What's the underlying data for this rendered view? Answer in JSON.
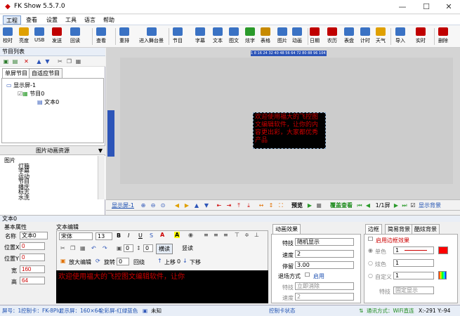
{
  "window": {
    "title": "FK Show 5.5.7.0",
    "minimize": "—",
    "maximize": "☐",
    "close": "✕"
  },
  "menu": [
    "工程",
    "查看",
    "设置",
    "工具",
    "语言",
    "帮助"
  ],
  "toolbar": [
    {
      "label": "校时",
      "icon": "clock-icon",
      "color": "#3a72c4"
    },
    {
      "label": "亮度",
      "icon": "brightness-icon",
      "color": "#e0a000"
    },
    {
      "label": "USB",
      "icon": "usb-icon",
      "color": "#3a72c4"
    },
    {
      "label": "发送",
      "icon": "send-icon",
      "color": "#c00000"
    },
    {
      "label": "回读",
      "icon": "readback-icon",
      "color": "#3a72c4"
    },
    {
      "label": "查看",
      "icon": "view-icon",
      "color": "#3a72c4"
    },
    {
      "label": "重排",
      "icon": "rearrange-icon",
      "color": "#3a72c4"
    },
    {
      "label": "进入舞台景",
      "icon": "stage-icon",
      "color": "#3a72c4"
    },
    {
      "label": "节目",
      "icon": "program-icon",
      "color": "#3a72c4"
    },
    {
      "label": "字幕",
      "icon": "subtitle-icon",
      "color": "#3a72c4"
    },
    {
      "label": "文本",
      "icon": "text-icon",
      "color": "#3a72c4"
    },
    {
      "label": "图文",
      "icon": "picture-text-icon",
      "color": "#3a72c4"
    },
    {
      "label": "炫字",
      "icon": "fancy-text-icon",
      "color": "#2a9a2a"
    },
    {
      "label": "表格",
      "icon": "table-icon",
      "color": "#c78a00"
    },
    {
      "label": "图片",
      "icon": "image-icon",
      "color": "#3a72c4"
    },
    {
      "label": "动画",
      "icon": "animation-icon",
      "color": "#3a72c4"
    },
    {
      "label": "日期",
      "icon": "date-icon",
      "color": "#c00000"
    },
    {
      "label": "农历",
      "icon": "lunar-icon",
      "color": "#c00000"
    },
    {
      "label": "表盘",
      "icon": "dial-icon",
      "color": "#3a72c4"
    },
    {
      "label": "计时",
      "icon": "timer-icon",
      "color": "#3a72c4"
    },
    {
      "label": "天气",
      "icon": "weather-icon",
      "color": "#e0a000"
    },
    {
      "label": "导入",
      "icon": "import-icon",
      "color": "#3a72c4"
    },
    {
      "label": "实时",
      "icon": "realtime-icon",
      "color": "#c00000"
    },
    {
      "label": "删除",
      "icon": "delete-icon",
      "color": "#c00000"
    }
  ],
  "left": {
    "header": "节目列表",
    "tabs": [
      "单屏节目",
      "自适应节目"
    ],
    "tree": [
      "显示屏-1",
      "节目0",
      "文本0"
    ],
    "res_header": "图片动画资源",
    "res_items": [
      "图片",
      "灯箱",
      "字幕",
      "运动",
      "节目",
      "播庆",
      "标志",
      "水洗"
    ]
  },
  "canvas": {
    "ruler_text": "1 8 16 24 32 40 48 56 64 72 80 88 96 104 112 120 128 136 144 152 160",
    "led_text": "欢迎使用福大的飞控图文编辑软件，让你的内容更出彩，大家都优秀产品"
  },
  "nav": {
    "screen": "显示屏-1",
    "preview": "预览",
    "cover": "覆盖查看",
    "page": "1/1屏",
    "show_bg": "显示背景"
  },
  "section": {
    "title": "文本0"
  },
  "props": {
    "title": "基本属性",
    "name_label": "名称",
    "name": "文本0",
    "x_label": "位置X",
    "x": "0",
    "y_label": "位置Y",
    "y": "0",
    "w_label": "宽",
    "w": "160",
    "h_label": "高",
    "h": "64"
  },
  "editor": {
    "title": "文本编辑",
    "font": "宋体",
    "size": "13",
    "b": "B",
    "i": "I",
    "u": "U",
    "rot_label": "旋转",
    "rot": "0",
    "wrap_label": "回绕",
    "horiz": "横读",
    "vert": "竖读",
    "zoom": "放大编辑",
    "up": "上移",
    "up_val": "0",
    "down": "下移",
    "content": "欢迎使用福大的飞控图文编辑软件，让你"
  },
  "anim": {
    "tab": "动画效果",
    "effect_label": "特技",
    "effect": "随机显示",
    "speed_label": "速度",
    "speed": "2",
    "stay_label": "停留",
    "stay": "3.00",
    "exit_label": "退场方式",
    "enable": "启用",
    "exit_effect_label": "特技",
    "exit_effect": "立即消除",
    "exit_speed_label": "速度",
    "exit_speed": "2"
  },
  "border": {
    "tabs": [
      "边框",
      "简易背景",
      "酷炫背景"
    ],
    "enable": "启用边框效果",
    "single": "单色",
    "single_val": "1",
    "color_opt": "炫色",
    "color_val": "1",
    "custom": "自定义",
    "custom_val": "1",
    "fx_label": "特技",
    "fx": "固定显示"
  },
  "status": {
    "screen": "屏号：1",
    "card": "控制卡：FK-8Plu",
    "display": "显示屏：160×64",
    "color": "全彩屏-红绿蓝色",
    "unknown": "未知",
    "card_status": "控制卡状态",
    "comm": "通讯方式：WiFi直连",
    "coords": "X:-291 Y:-94"
  },
  "colors": {
    "accent": "#2d55b8",
    "led_text": "#cc0000",
    "border_red": "#ff0000"
  }
}
